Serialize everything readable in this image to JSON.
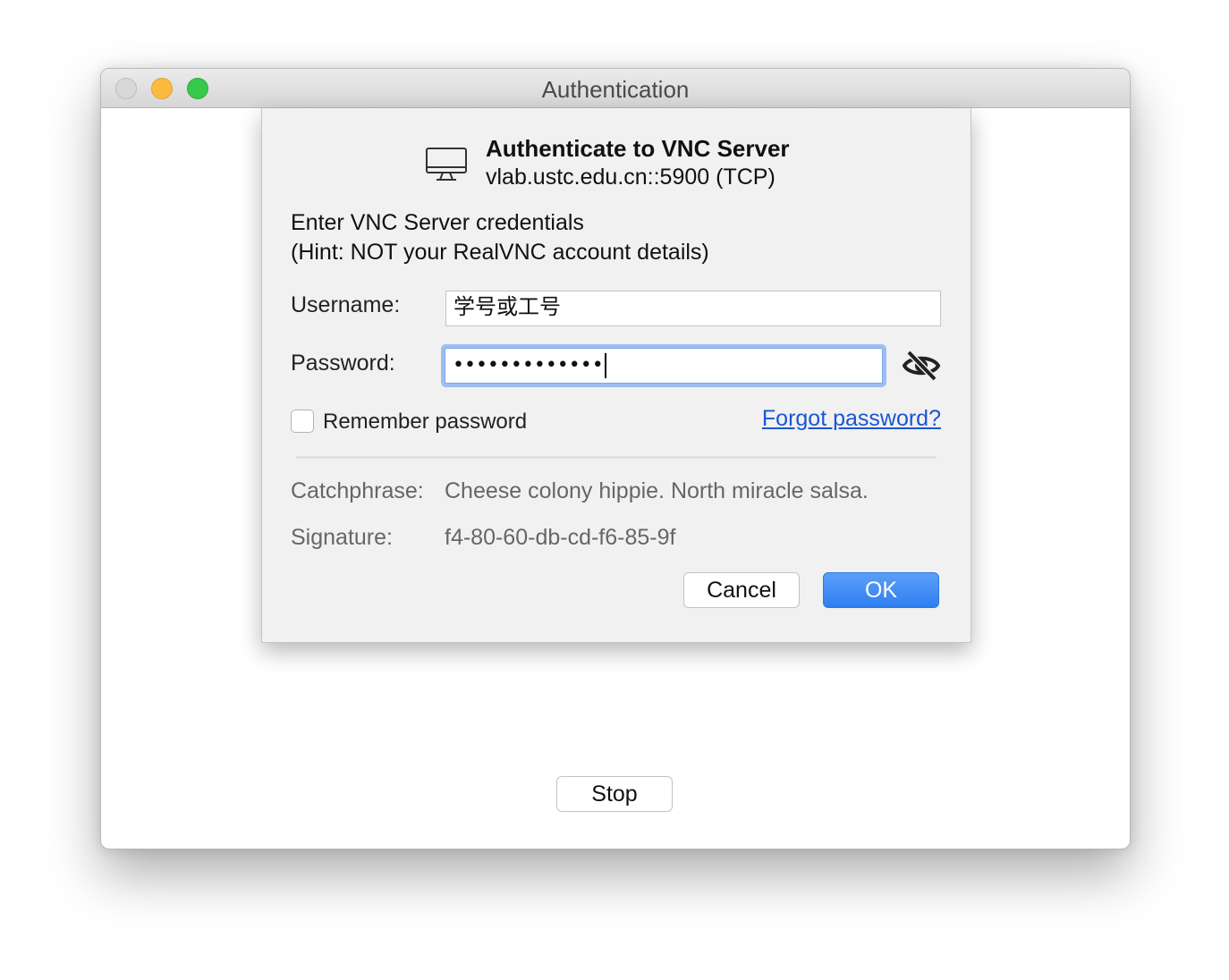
{
  "window": {
    "title": "Authentication"
  },
  "dialog": {
    "heading": "Authenticate to VNC Server",
    "server": "vlab.ustc.edu.cn::5900 (TCP)",
    "intro_line1": "Enter VNC Server credentials",
    "intro_line2": "(Hint: NOT your RealVNC account details)",
    "username_label": "Username:",
    "username_value": "学号或工号",
    "password_label": "Password:",
    "password_value": "•••••••••••••",
    "remember_label": "Remember password",
    "remember_checked": false,
    "forgot_link": "Forgot password?",
    "catchphrase_label": "Catchphrase:",
    "catchphrase_value": "Cheese colony hippie. North miracle salsa.",
    "signature_label": "Signature:",
    "signature_value": "f4-80-60-db-cd-f6-85-9f",
    "cancel_label": "Cancel",
    "ok_label": "OK"
  },
  "footer": {
    "stop_label": "Stop"
  },
  "icons": {
    "monitor": "monitor-icon",
    "visibility": "eye-slash-icon"
  },
  "colors": {
    "accent": "#2f7ff2",
    "link": "#1a55d6",
    "focus_ring": "#9cbef0"
  }
}
